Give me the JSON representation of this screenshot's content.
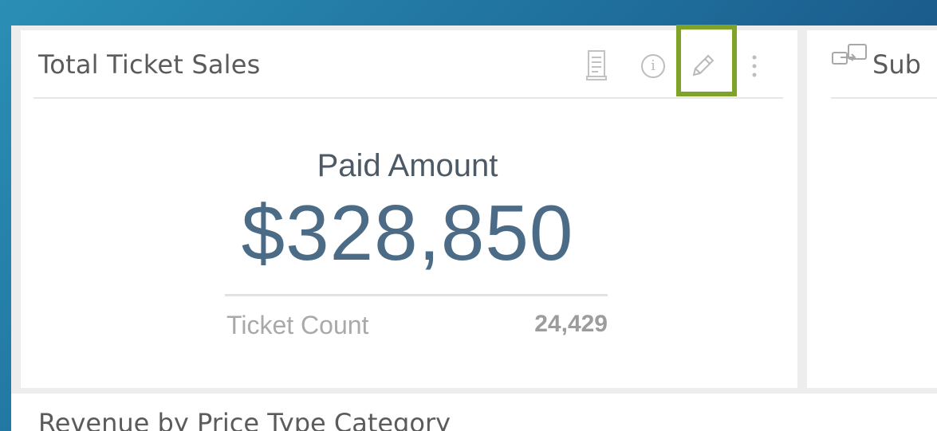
{
  "widget": {
    "title": "Total Ticket Sales",
    "metric_label": "Paid Amount",
    "metric_value": "$328,850",
    "secondary_label": "Ticket Count",
    "secondary_value": "24,429"
  },
  "header_icons": [
    "report-icon",
    "info-icon",
    "edit-icon",
    "more-vertical-icon"
  ],
  "side_widget": {
    "title": "Sub",
    "icon": "transfer-icon"
  },
  "bottom_widget": {
    "title": "Revenue by Price Type Category"
  },
  "highlight": {
    "target": "edit-icon",
    "color": "#7fa328"
  },
  "colors": {
    "metric": "#4b6b86",
    "title": "#5b5b5b",
    "background_top": "#2a8fb5",
    "background_bottom": "#16457a"
  }
}
